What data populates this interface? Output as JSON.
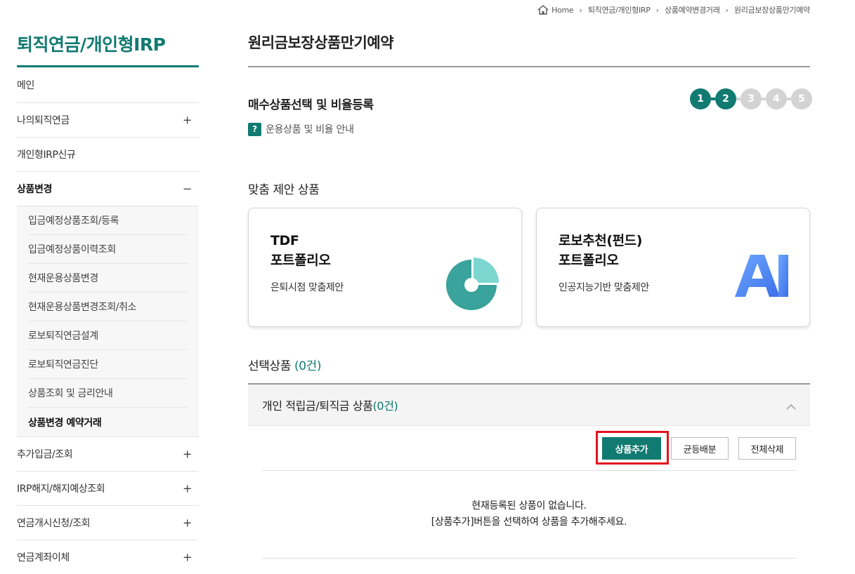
{
  "breadcrumb": {
    "home": "Home",
    "items": [
      "퇴직연금/개인형IRP",
      "상품예약변경거래",
      "원리금보장상품만기예약"
    ]
  },
  "sidebar": {
    "title": "퇴직연금/개인형IRP",
    "items": [
      {
        "label": "메인",
        "toggle": ""
      },
      {
        "label": "나의퇴직연금",
        "toggle": "+"
      },
      {
        "label": "개인형IRP신규",
        "toggle": ""
      },
      {
        "label": "상품변경",
        "toggle": "−"
      },
      {
        "label": "추가입금/조회",
        "toggle": "+"
      },
      {
        "label": "IRP해지/해지예상조회",
        "toggle": "+"
      },
      {
        "label": "연금개시신청/조회",
        "toggle": "+"
      },
      {
        "label": "연금계좌이체",
        "toggle": "+"
      }
    ],
    "submenu": [
      "입금예정상품조회/등록",
      "입금예정상품이력조회",
      "현재운용상품변경",
      "현재운용상품변경조회/취소",
      "로보퇴직연금설계",
      "로보퇴직연금진단",
      "상품조회 및 금리안내",
      "상품변경 예약거래"
    ]
  },
  "main": {
    "page_title": "원리금보장상품만기예약",
    "section_title": "매수상품선택 및 비율등록",
    "guide_link": "운용상품 및 비율 안내",
    "guide_icon": "?",
    "steps": [
      "1",
      "2",
      "3",
      "4",
      "5"
    ],
    "current_step": 2,
    "reco_title": "맞춤 제안 상품",
    "cards": [
      {
        "title_line1": "TDF",
        "title_line2": "포트폴리오",
        "desc": "은퇴시점 맞춤제안",
        "icon": "pie-chart-icon"
      },
      {
        "title_line1": "로보추천(펀드)",
        "title_line2": "포트폴리오",
        "desc": "인공지능기반 맞춤제안",
        "icon": "ai-icon",
        "icon_text": "AI"
      }
    ],
    "selected_title": "선택상품",
    "selected_count": "(0건)",
    "accordion_title": "개인 적립금/퇴직금 상품",
    "accordion_count": "(0건)",
    "buttons": {
      "add": "상품추가",
      "equal": "균등배분",
      "delete_all": "전체삭제"
    },
    "empty_line1": "현재등록된 상품이 없습니다.",
    "empty_line2": "[상품추가]버튼을 선택하여 상품을 추가해주세요."
  },
  "colors": {
    "accent": "#117a71",
    "highlight": "#e3121e",
    "step_inactive": "#d3d3d3"
  }
}
